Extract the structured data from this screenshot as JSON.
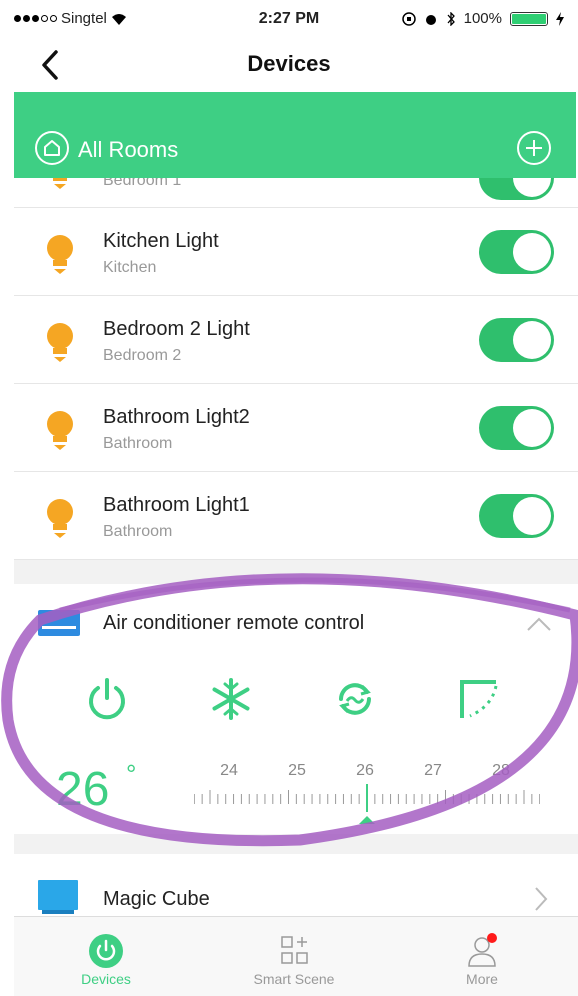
{
  "status_bar": {
    "carrier": "Singtel",
    "time": "2:27 PM",
    "battery": "100%"
  },
  "nav": {
    "title": "Devices"
  },
  "rooms_header": {
    "label": "All Rooms"
  },
  "devices": [
    {
      "name": "",
      "room": "Bedroom 1",
      "on": true
    },
    {
      "name": "Kitchen Light",
      "room": "Kitchen",
      "on": true
    },
    {
      "name": "Bedroom 2 Light",
      "room": "Bedroom 2",
      "on": true
    },
    {
      "name": "Bathroom Light2",
      "room": "Bathroom",
      "on": true
    },
    {
      "name": "Bathroom Light1",
      "room": "Bathroom",
      "on": true
    }
  ],
  "ac": {
    "title": "Air conditioner remote control",
    "temperature": "26",
    "degree": "°",
    "ruler_labels": [
      "24",
      "25",
      "26",
      "27",
      "28"
    ],
    "selected": 26,
    "controls": [
      "power-icon",
      "snowflake-icon",
      "mode-cycle-icon",
      "swing-icon"
    ]
  },
  "magic_cube": {
    "name": "Magic Cube"
  },
  "tabs": [
    {
      "label": "Devices",
      "icon": "power-icon",
      "active": true
    },
    {
      "label": "Smart Scene",
      "icon": "scene-grid-icon",
      "active": false
    },
    {
      "label": "More",
      "icon": "user-icon",
      "active": false,
      "badge": true
    }
  ],
  "colors": {
    "brand_green": "#3ecf84",
    "toggle_green": "#2fbf6d",
    "bulb_orange": "#f5a623",
    "annotation_purple": "#a45ec2"
  }
}
